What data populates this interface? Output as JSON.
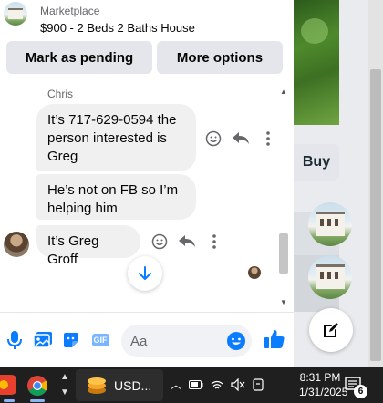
{
  "listing": {
    "category": "Marketplace",
    "title": "$900 - 2 Beds 2 Baths House",
    "mark_pending_label": "Mark as pending",
    "more_options_label": "More options"
  },
  "conversation": {
    "sender_name": "Chris",
    "messages": [
      {
        "text": "It’s 717-629-0594 the person interested is Greg"
      },
      {
        "text": "He’s not on FB so I’m helping him"
      },
      {
        "text": "It’s Greg Groff"
      }
    ]
  },
  "composer": {
    "placeholder": "Aa",
    "gif_label": "GIF"
  },
  "background": {
    "buy_label": "Buy"
  },
  "taskbar": {
    "widget_label": "USD...",
    "time": "8:31 PM",
    "date": "1/31/2025",
    "notification_count": "6"
  },
  "colors": {
    "accent": "#0a7cff",
    "bubble": "#f0f0f0",
    "button_bg": "#e4e6eb"
  }
}
